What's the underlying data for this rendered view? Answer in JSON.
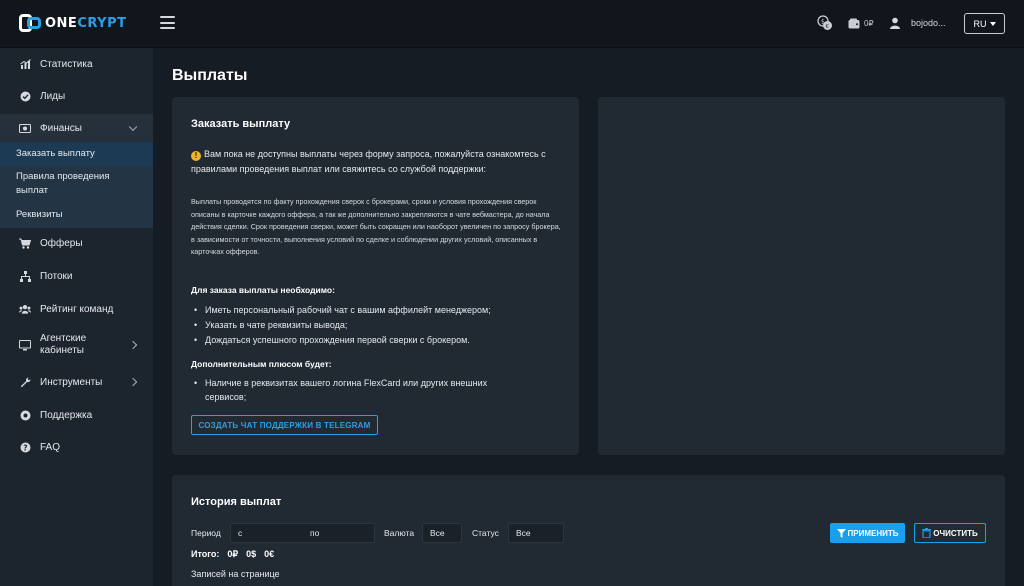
{
  "header": {
    "logo": {
      "part1": "ONE",
      "part2": "CRYPT"
    },
    "balance": "0₽",
    "username": "bojodo...",
    "language": "RU"
  },
  "sidebar": {
    "items": [
      {
        "label": "Статистика",
        "icon": "chart-icon"
      },
      {
        "label": "Лиды",
        "icon": "check-circle-icon"
      },
      {
        "label": "Финансы",
        "icon": "money-icon"
      },
      {
        "label": "Офферы",
        "icon": "cart-icon"
      },
      {
        "label": "Потоки",
        "icon": "sitemap-icon"
      },
      {
        "label": "Рейтинг команд",
        "icon": "users-icon"
      },
      {
        "label": "Агентские кабинеты",
        "icon": "monitor-icon"
      },
      {
        "label": "Инструменты",
        "icon": "wrench-icon"
      },
      {
        "label": "Поддержка",
        "icon": "support-icon"
      },
      {
        "label": "FAQ",
        "icon": "question-icon"
      }
    ],
    "finance_sub": [
      {
        "label": "Заказать выплату"
      },
      {
        "label": "Правила проведения выплат"
      },
      {
        "label": "Реквизиты"
      }
    ]
  },
  "main": {
    "page_title": "Выплаты",
    "order": {
      "title": "Заказать выплату",
      "notice": "Вам пока не доступны выплаты через форму запроса, пожалуйста ознакомтесь с правилами проведения выплат или свяжитесь со службой поддержки:",
      "details": "Выплаты проводятся по факту прохождения сверок с брокерами, сроки и условия прохождения сверок описаны в карточке каждого оффера, а так же дополнительно закрепляются в чате вебмастера, до начала действия сделки. Срок проведения сверки, может быть сокращен или наоборот увеличен по запросу брокера, в зависимости от точности, выполнения условий по сделке и соблюдении других условий, описанных в карточках офферов.",
      "required_title": "Для заказа выплаты необходимо:",
      "required": [
        "Иметь персональный рабочий чат с вашим аффилейт менеджером;",
        "Указать в чате реквизиты вывода;",
        "Дождаться успешного прохождения первой сверки с брокером."
      ],
      "plus_title": "Дополнительным плюсом будет:",
      "plus": [
        "Наличие в реквизитах вашего логина FlexCard или других внешних сервисов;"
      ],
      "telegram_button": "СОЗДАТЬ ЧАТ ПОДДЕРЖКИ В TELEGRAM"
    },
    "history": {
      "title": "История выплат",
      "period_label": "Период",
      "period_from": "с",
      "period_to": "по",
      "currency_label": "Валюта",
      "currency_value": "Все",
      "status_label": "Статус",
      "status_value": "Все",
      "apply_button": "ПРИМЕНИТЬ",
      "clear_button": "ОЧИСТИТЬ",
      "totals_label": "Итого:",
      "totals": [
        "0₽",
        "0$",
        "0€"
      ],
      "per_page_label": "Записей на странице"
    }
  },
  "colors": {
    "accent": "#18a0ee",
    "warning": "#f0b429",
    "background": "#161c23",
    "card": "#212a33"
  }
}
